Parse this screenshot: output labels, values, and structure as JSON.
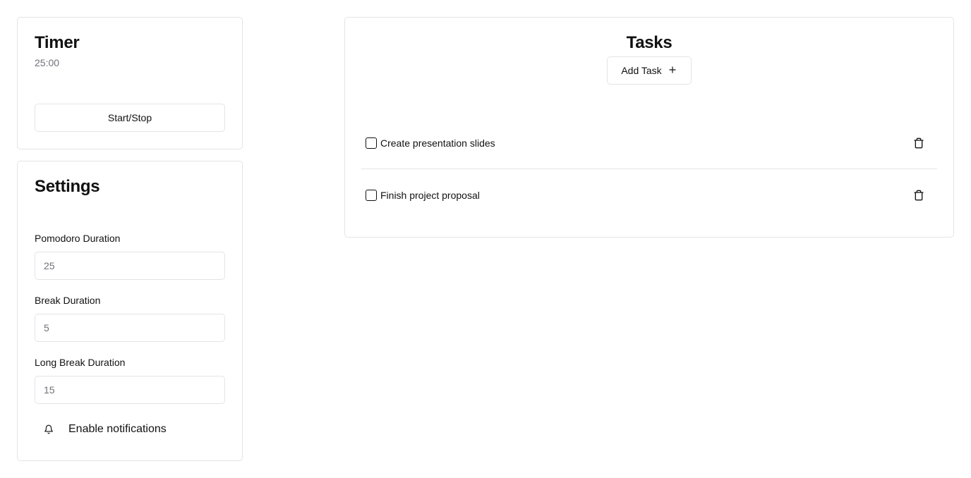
{
  "timer": {
    "title": "Timer",
    "time": "25:00",
    "start_stop_label": "Start/Stop"
  },
  "settings": {
    "title": "Settings",
    "pomodoro": {
      "label": "Pomodoro Duration",
      "placeholder": "25",
      "value": ""
    },
    "break": {
      "label": "Break Duration",
      "placeholder": "5",
      "value": ""
    },
    "long_break": {
      "label": "Long Break Duration",
      "placeholder": "15",
      "value": ""
    },
    "notifications": {
      "label": "Enable notifications",
      "icon": "bell-icon"
    }
  },
  "tasks": {
    "title": "Tasks",
    "add_label": "Add Task",
    "add_icon": "plus-icon",
    "items": [
      {
        "label": "Create presentation slides",
        "checked": false,
        "delete_icon": "trash-icon"
      },
      {
        "label": "Finish project proposal",
        "checked": false,
        "delete_icon": "trash-icon"
      }
    ]
  },
  "colors": {
    "border": "#e4e4e7",
    "text": "#111111",
    "muted": "#71717a",
    "background": "#ffffff"
  }
}
